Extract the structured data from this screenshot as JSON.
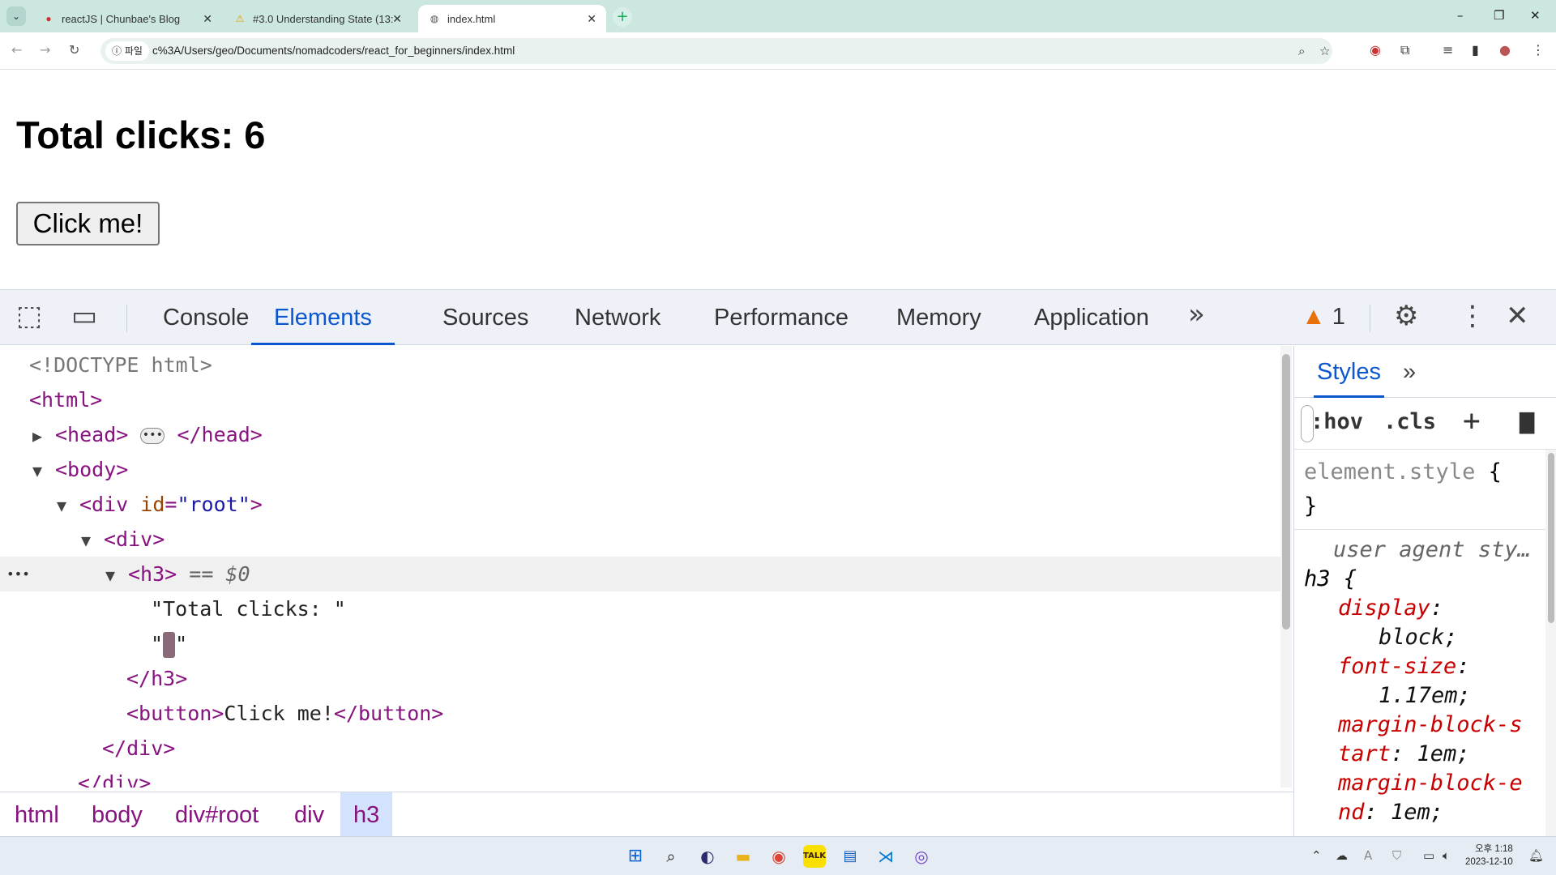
{
  "browser": {
    "tabs": [
      {
        "title": "reactJS | Chunbae's Blog",
        "icon": "blog-favicon-icon",
        "active": false
      },
      {
        "title": "#3.0 Understanding State (13:",
        "icon": "warning-favicon-icon",
        "active": false
      },
      {
        "title": "index.html",
        "icon": "globe-icon",
        "active": true
      }
    ],
    "site_chip": "파일",
    "url": "c%3A/Users/geo/Documents/nomadcoders/react_for_beginners/index.html"
  },
  "page": {
    "heading": "Total clicks: 6",
    "button_label": "Click me!"
  },
  "devtools": {
    "tabs": [
      "Console",
      "Elements",
      "Sources",
      "Network",
      "Performance",
      "Memory",
      "Application"
    ],
    "active_tab": "Elements",
    "warning_count": "1",
    "tree": {
      "doctype": "<!DOCTYPE html>",
      "html_open": "<html>",
      "head_open": "<head>",
      "head_ellipsis": "•••",
      "head_close": "</head>",
      "body_open": "<body>",
      "div_open_pre": "<div ",
      "div_attr_name": "id",
      "div_attr_eq": "=",
      "div_attr_val": "\"root\"",
      "div_close_bracket": ">",
      "inner_div_open": "<div>",
      "row_dots": "•••",
      "h3_open": "<h3>",
      "h3_marker": "== $0",
      "text_node_1": "\"Total clicks: \"",
      "text_node_2_open": "\"",
      "text_node_2_close": "\"",
      "h3_close": "</h3>",
      "button_open": "<button>",
      "button_text": "Click me!",
      "button_close": "</button>",
      "inner_div_close": "</div>",
      "outer_div_close": "</div>"
    },
    "breadcrumbs": [
      "html",
      "body",
      "div#root",
      "div",
      "h3"
    ],
    "styles": {
      "tab_label": "Styles",
      "hov": ":hov",
      "cls": ".cls",
      "element_style": "element.style",
      "open_brace": "{",
      "close_brace": "}",
      "ua_label": "user agent sty…",
      "selector": "h3",
      "properties": [
        {
          "name": "display",
          "value": "block;"
        },
        {
          "name": "font-size",
          "value": "1.17em;"
        },
        {
          "name": "margin-block-start",
          "value": "1em;"
        },
        {
          "name": "margin-block-end",
          "value": "1em;"
        }
      ]
    }
  },
  "taskbar": {
    "time": "오후 1:18",
    "date": "2023-12-10"
  }
}
